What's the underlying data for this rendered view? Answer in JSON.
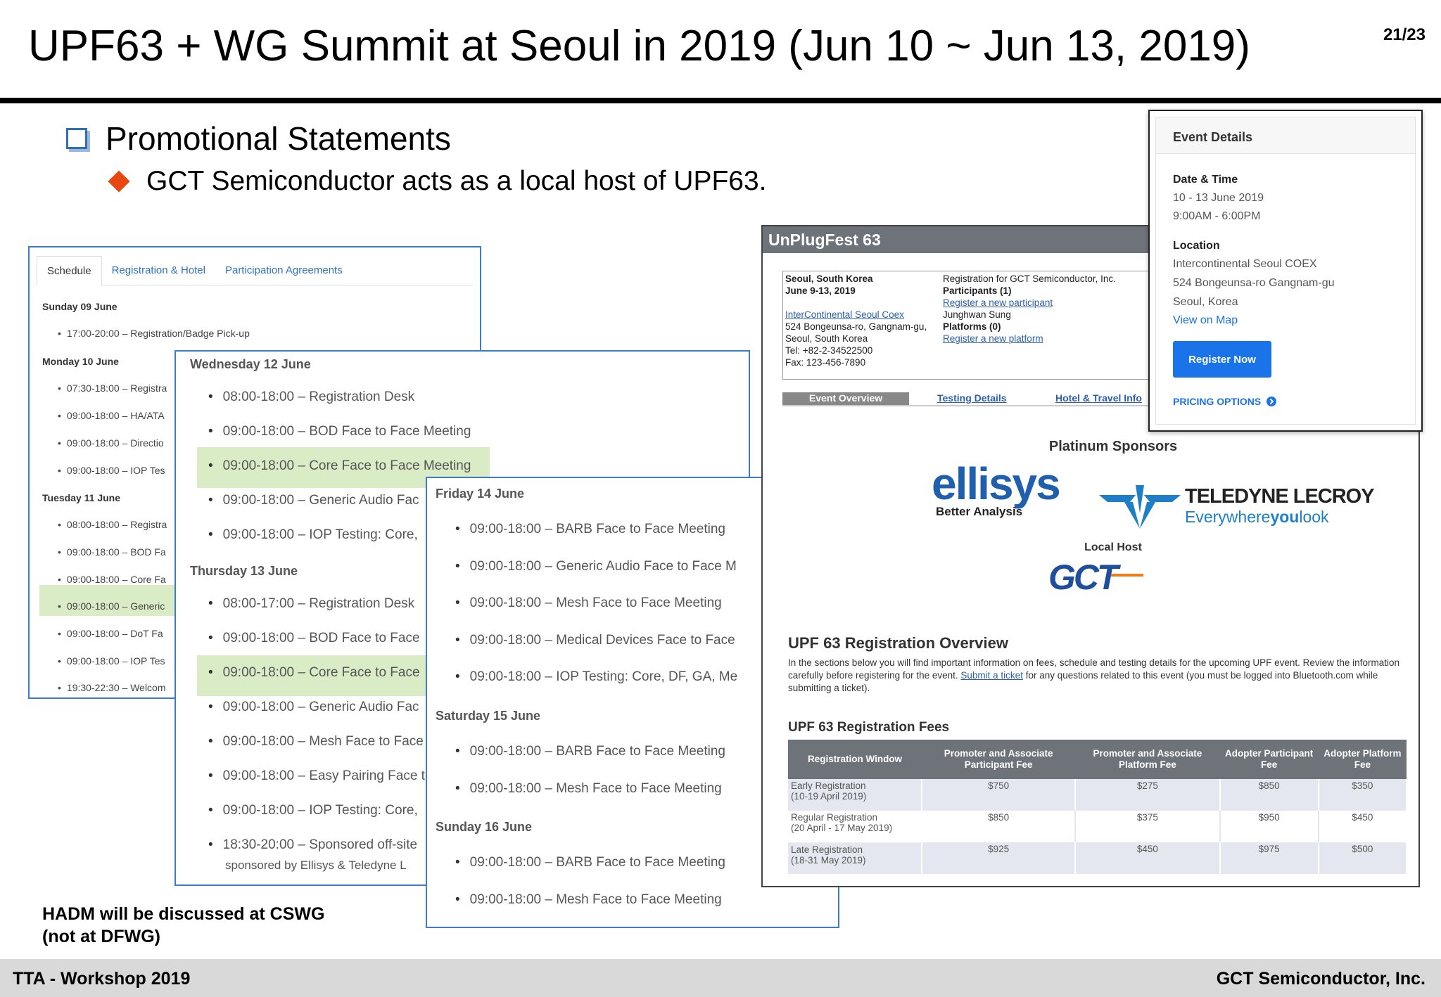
{
  "slide": {
    "title": "UPF63 + WG Summit at Seoul in 2019 (Jun 10 ~ Jun 13, 2019)",
    "page": "21/23",
    "bullet_level1": "Promotional Statements",
    "bullet_level2": "GCT Semiconductor acts as a local host of UPF63.",
    "note_line1": "HADM will be discussed at CSWG",
    "note_line2": "(not at DFWG)"
  },
  "schedule_tabs": [
    "Schedule",
    "Registration & Hotel",
    "Participation Agreements"
  ],
  "schedule_small": {
    "days": [
      "Sunday 09 June",
      "Monday 10 June",
      "Tuesday 11 June"
    ],
    "items": [
      "17:00-20:00 – Registration/Badge Pick-up",
      "07:30-18:00 – Registra",
      "09:00-18:00 – HA/ATA",
      "09:00-18:00 – Directio",
      "09:00-18:00 –  IOP Tes",
      "08:00-18:00 – Registra",
      "09:00-18:00 – BOD Fa",
      "09:00-18:00 – Core Fa",
      "09:00-18:00 – Generic",
      "09:00-18:00 – DoT Fa",
      "09:00-18:00 – IOP Tes",
      "19:30-22:30 – Welcom"
    ]
  },
  "schedule_mid": {
    "days": [
      "Wednesday 12 June",
      "Thursday 13 June"
    ],
    "items": [
      "08:00-18:00 – Registration Desk",
      "09:00-18:00 – BOD Face to Face Meeting",
      "09:00-18:00 – Core Face to Face Meeting",
      "09:00-18:00 – Generic Audio Fac",
      "09:00-18:00 – IOP Testing: Core,",
      "08:00-17:00 – Registration Desk",
      "09:00-18:00 – BOD Face to Face",
      "09:00-18:00 – Core Face to Face",
      "09:00-18:00 – Generic Audio Fac",
      "09:00-18:00 – Mesh Face to Face",
      "09:00-18:00 – Easy Pairing Face t",
      "09:00-18:00 – IOP Testing: Core,",
      "18:30-20:00 – Sponsored off-site",
      "sponsored by Ellisys & Teledyne L"
    ]
  },
  "schedule_front": {
    "days": [
      "Friday 14 June",
      "Saturday 15 June",
      "Sunday 16 June"
    ],
    "items": [
      "09:00-18:00 – BARB Face to Face Meeting",
      "09:00-18:00 – Generic Audio Face to Face M",
      "09:00-18:00 – Mesh Face to Face Meeting",
      "09:00-18:00 – Medical Devices Face to Face",
      "09:00-18:00 – IOP Testing: Core, DF, GA, Me",
      "09:00-18:00 – BARB Face to Face Meeting",
      "09:00-18:00 – Mesh Face to Face Meeting",
      "09:00-18:00 – BARB Face to Face Meeting",
      "09:00-18:00 – Mesh Face to Face Meeting"
    ]
  },
  "upf": {
    "title": "UnPlugFest 63",
    "city": "Seoul, South Korea",
    "dates": "June 9-13, 2019",
    "venue_link": "InterContinental Seoul Coex",
    "address1": "524 Bongeunsa-ro, Gangnam-gu,",
    "address2": "Seoul, South Korea",
    "tel": "Tel: +82-2-34522500",
    "fax": "Fax: 123-456-7890",
    "reg_for": "Registration for GCT Semiconductor, Inc.",
    "participants": "Participants (1)",
    "reg_participant": "Register a new participant",
    "participant_name": "Junghwan Sung",
    "platforms": "Platforms (0)",
    "reg_platform": "Register a new platform",
    "tabs": [
      "Event Overview",
      "Testing Details",
      "Hotel & Travel Info"
    ],
    "platinum": "Platinum Sponsors",
    "ellisys": "ellisys",
    "ellisys_tag": "Better Analysis",
    "teledyne": "TELEDYNE LECROY",
    "teledyne_tag1": "Everywhere",
    "teledyne_tag2": "you",
    "teledyne_tag3": "look",
    "local_host": "Local Host",
    "gct": "GCT",
    "overview_title": "UPF 63 Registration Overview",
    "overview_text_a": "In the sections below you will find important information on fees, schedule and testing details for the upcoming UPF event. Review the information carefully before registering for the event.",
    "overview_link": "Submit a ticket",
    "overview_text_b": "for any questions related to this event (you must be logged into Bluetooth.com while submitting a ticket).",
    "fees_title": "UPF 63 Registration Fees",
    "fee_headers": [
      "Registration Window",
      "Promoter and Associate Participant Fee",
      "Promoter and Associate Platform Fee",
      "Adopter Participant Fee",
      "Adopter Platform Fee"
    ],
    "fee_rows": [
      {
        "window1": "Early Registration",
        "window2": "(10-19 April 2019)",
        "v": [
          "$750",
          "$275",
          "$850",
          "$350"
        ]
      },
      {
        "window1": "Regular Registration",
        "window2": "(20 April - 17 May 2019)",
        "v": [
          "$850",
          "$375",
          "$950",
          "$450"
        ]
      },
      {
        "window1": "Late Registration",
        "window2": "(18-31 May 2019)",
        "v": [
          "$925",
          "$450",
          "$975",
          "$500"
        ]
      }
    ]
  },
  "event_details": {
    "title": "Event Details",
    "date_label": "Date & Time",
    "date": "10 - 13 June 2019",
    "time": "9:00AM - 6:00PM",
    "location_label": "Location",
    "venue": "Intercontinental Seoul COEX",
    "street": "524 Bongeunsa-ro Gangnam-gu",
    "city": "Seoul, Korea",
    "map_link": "View on Map",
    "register": "Register Now",
    "pricing": "PRICING OPTIONS"
  },
  "footer": {
    "left": "TTA - Workshop 2019",
    "right": "GCT Semiconductor, Inc."
  },
  "colors": {
    "highlight_green": "#d9ecc6",
    "panel_border_blue": "#3d7cc9",
    "diamond_orange": "#e8470f",
    "button_blue": "#1a73e8"
  }
}
